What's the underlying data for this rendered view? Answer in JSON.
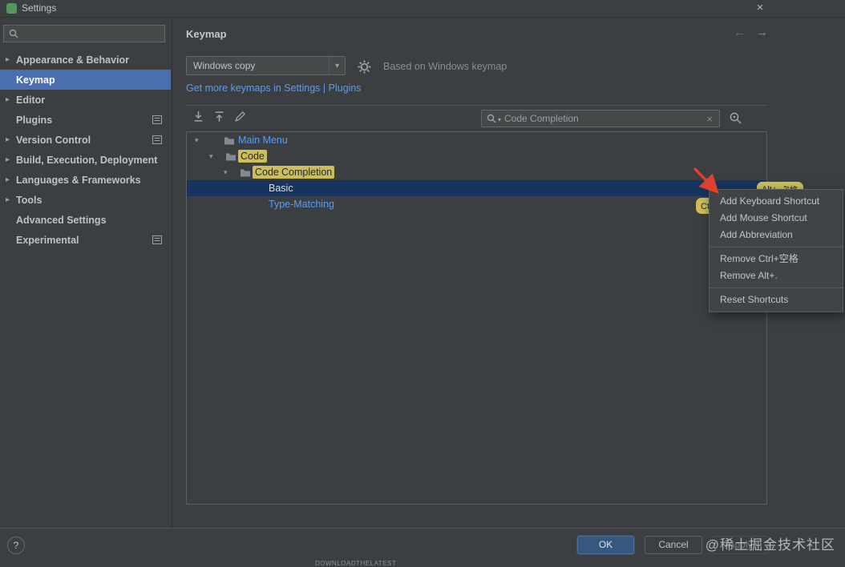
{
  "window": {
    "title": "Settings"
  },
  "icons": {
    "chevron_collapsed": "▸",
    "chevron_expanded": "▾",
    "dropdown_arrow": "▾",
    "close": "×",
    "clear": "×",
    "back": "←",
    "forward": "→",
    "help": "?"
  },
  "sidebar": {
    "items": [
      {
        "label": "Appearance & Behavior"
      },
      {
        "label": "Keymap"
      },
      {
        "label": "Editor"
      },
      {
        "label": "Plugins"
      },
      {
        "label": "Version Control"
      },
      {
        "label": "Build, Execution, Deployment"
      },
      {
        "label": "Languages & Frameworks"
      },
      {
        "label": "Tools"
      },
      {
        "label": "Advanced Settings"
      },
      {
        "label": "Experimental"
      }
    ]
  },
  "header": {
    "title": "Keymap"
  },
  "scheme": {
    "selected": "Windows copy",
    "based_on": "Based on Windows keymap",
    "more_link": "Get more keymaps in Settings | Plugins"
  },
  "search": {
    "value": "Code Completion"
  },
  "tree": {
    "main_menu": "Main Menu",
    "code": "Code",
    "code_completion_a": "Code",
    "code_completion_b": "Completion",
    "basic": "Basic",
    "basic_shortcut_1": "Ctrl+空格",
    "basic_shortcut_2": "Alt+.",
    "type_matching": "Type-Matching",
    "type_matching_shortcut": "Ctrl+Shift+空格"
  },
  "context_menu": {
    "items": [
      {
        "label": "Add Keyboard Shortcut"
      },
      {
        "label": "Add Mouse Shortcut"
      },
      {
        "label": "Add Abbreviation"
      },
      {
        "label": "Remove Ctrl+空格"
      },
      {
        "label": "Remove Alt+."
      },
      {
        "label": "Reset Shortcuts"
      }
    ]
  },
  "footer": {
    "ok": "OK",
    "cancel": "Cancel",
    "apply": "Apply"
  },
  "watermark": "@稀土掘金技术社区",
  "clipped_bottom_text": "DOWNLOADTHELATEST",
  "colors": {
    "sidebar_selection": "#4b6eaf",
    "tree_selection": "#17345f",
    "link_blue": "#589df6",
    "highlight_yellow": "#cdbe59",
    "ok_button": "#365880",
    "annotation_red": "#e0402e"
  }
}
